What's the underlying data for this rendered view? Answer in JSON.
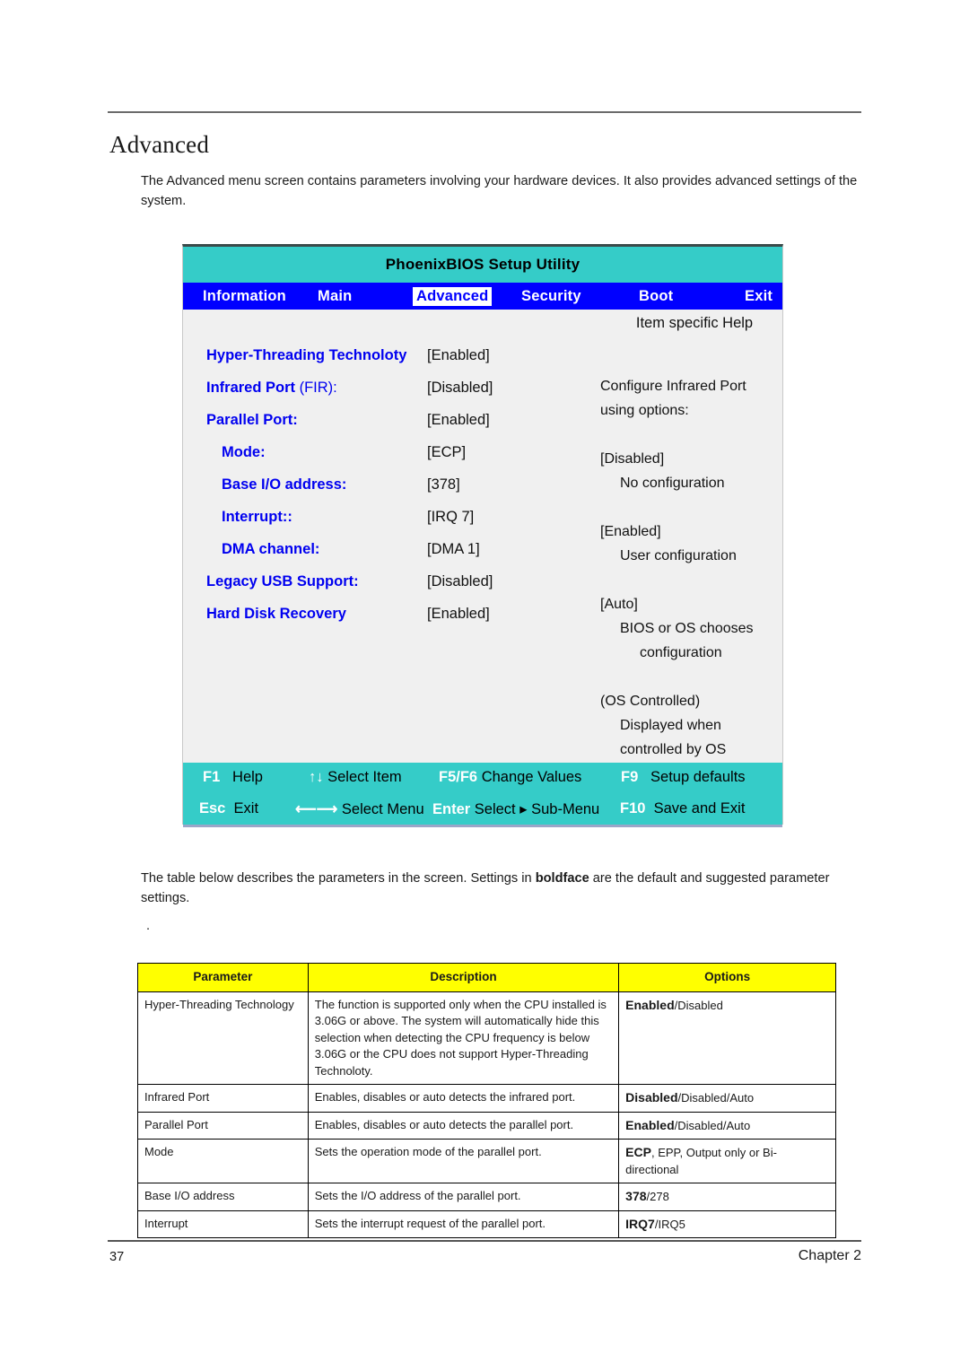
{
  "document": {
    "heading": "Advanced",
    "intro": "The Advanced menu screen contains parameters involving your hardware devices. It also provides advanced settings of the system.",
    "table_intro_part1": "The table below describes the parameters in the screen. Settings in ",
    "table_intro_bold": "boldface",
    "table_intro_part2": " are the default and suggested parameter settings.",
    "stray_mark": ".",
    "page_number": "37",
    "chapter_label": "Chapter 2"
  },
  "bios": {
    "title": "PhoenixBIOS Setup Utility",
    "menu": [
      {
        "label": "Information",
        "active": false
      },
      {
        "label": "Main",
        "active": false
      },
      {
        "label": "Advanced",
        "active": true
      },
      {
        "label": "Security",
        "active": false
      },
      {
        "label": "Boot",
        "active": false
      },
      {
        "label": "Exit",
        "active": false
      }
    ],
    "help_title": "Item specific Help",
    "settings": [
      {
        "label": "Hyper-Threading Technoloty",
        "suffix": "",
        "value": "[Enabled]",
        "indent": false
      },
      {
        "label": "Infrared Port ",
        "suffix": "(FIR):",
        "value": "[Disabled]",
        "indent": false
      },
      {
        "label": "Parallel Port:",
        "suffix": "",
        "value": "[Enabled]",
        "indent": false
      },
      {
        "label": "Mode:",
        "suffix": "",
        "value": "[ECP]",
        "indent": true
      },
      {
        "label": "Base I/O address:",
        "suffix": "",
        "value": "[378]",
        "indent": true
      },
      {
        "label": "Interrupt::",
        "suffix": "",
        "value": "[IRQ 7]",
        "indent": true
      },
      {
        "label": "DMA channel:",
        "suffix": "",
        "value": "[DMA 1]",
        "indent": true
      },
      {
        "label": "Legacy USB Support:",
        "suffix": "",
        "value": "[Disabled]",
        "indent": false
      },
      {
        "label": "Hard Disk Recovery",
        "suffix": "",
        "value": "[Enabled]",
        "indent": false
      }
    ],
    "help_lines": [
      "Configure Infrared Port",
      "using options:",
      "[Disabled]",
      "No configuration",
      "[Enabled]",
      "User configuration",
      "[Auto]",
      "BIOS or OS chooses",
      "configuration",
      "(OS Controlled)",
      "Displayed when",
      "controlled by OS"
    ],
    "footer_keys": [
      {
        "key": "F1",
        "text": "Help"
      },
      {
        "key": "↑↓",
        "text": "Select Item"
      },
      {
        "key": "F5/F6",
        "text": "Change Values"
      },
      {
        "key": "F9",
        "text": "Setup defaults"
      },
      {
        "key": "Esc",
        "text": "Exit"
      },
      {
        "key": "⟵⟶",
        "text": "Select Menu"
      },
      {
        "key": "Enter",
        "text": "Select ▸ Sub-Menu"
      },
      {
        "key": "F10",
        "text": "Save and Exit"
      }
    ]
  },
  "param_table": {
    "headers": [
      "Parameter",
      "Description",
      "Options"
    ],
    "rows": [
      {
        "parameter": "Hyper-Threading Technology",
        "description": "The function is supported only when the CPU installed is 3.06G or above. The system will automatically hide this selection when detecting the CPU frequency is below 3.06G or the CPU does not support Hyper-Threading Technoloty.",
        "option_bold": "Enabled",
        "option_rest": "/Disabled"
      },
      {
        "parameter": "Infrared Port",
        "description": "Enables, disables or auto detects the infrared port.",
        "option_bold": "Disabled",
        "option_rest": "/Disabled/Auto"
      },
      {
        "parameter": "Parallel Port",
        "description": "Enables, disables or auto detects the parallel port.",
        "option_bold": "Enabled",
        "option_rest": "/Disabled/Auto"
      },
      {
        "parameter": "Mode",
        "description": "Sets the operation mode of the parallel port.",
        "option_bold": "ECP",
        "option_rest": ", EPP, Output only or Bi-directional"
      },
      {
        "parameter": "Base I/O address",
        "description": "Sets the I/O address of the parallel port.",
        "option_bold": "378",
        "option_rest": "/278"
      },
      {
        "parameter": "Interrupt",
        "description": "Sets the interrupt request of the parallel port.",
        "option_bold": "IRQ7",
        "option_rest": "/IRQ5"
      }
    ]
  },
  "colors": {
    "bios_title_bg": "#35ccc8",
    "bios_menu_bg": "#0000ff",
    "bios_label": "#0000f0",
    "bios_body_bg": "#f0f0f0",
    "table_header_bg": "#ffff00"
  }
}
